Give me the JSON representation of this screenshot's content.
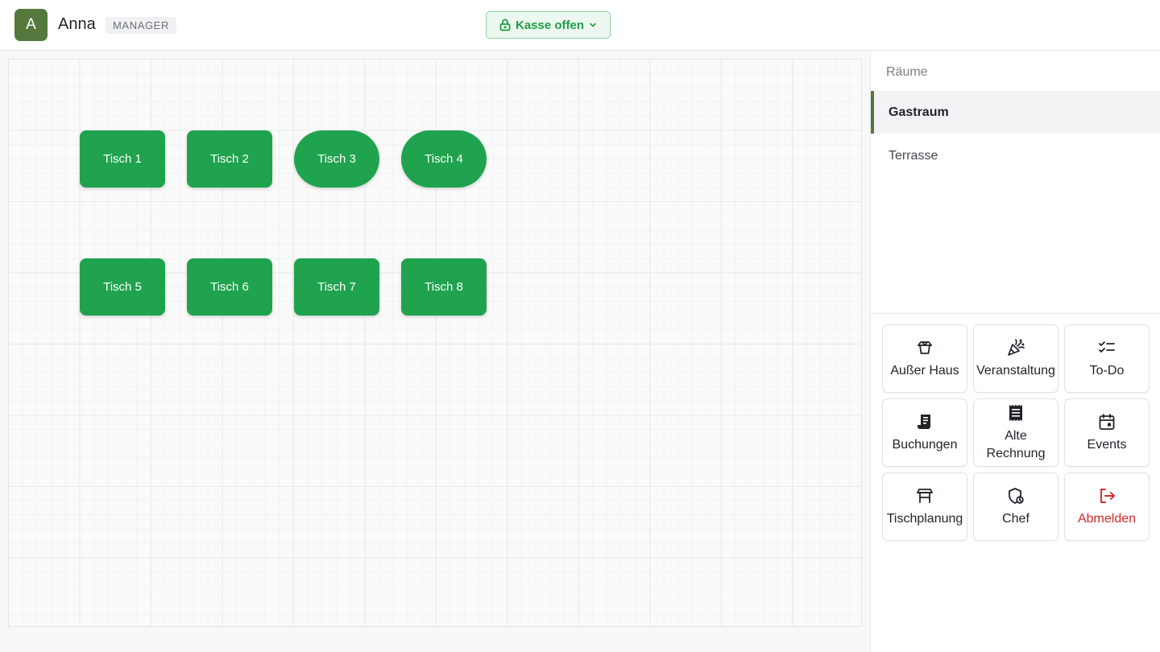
{
  "header": {
    "avatar_letter": "A",
    "user_name": "Anna",
    "role": "MANAGER",
    "kasse_label": "Kasse offen",
    "accent_green": "#1e9e48"
  },
  "floor": {
    "tables": [
      {
        "label": "Tisch 1",
        "shape": "rect"
      },
      {
        "label": "Tisch 2",
        "shape": "rect"
      },
      {
        "label": "Tisch 3",
        "shape": "round"
      },
      {
        "label": "Tisch 4",
        "shape": "round"
      },
      {
        "label": "Tisch 5",
        "shape": "rect"
      },
      {
        "label": "Tisch 6",
        "shape": "rect"
      },
      {
        "label": "Tisch 7",
        "shape": "rect"
      },
      {
        "label": "Tisch 8",
        "shape": "rect"
      }
    ],
    "table_color": "#1fa34e"
  },
  "sidebar": {
    "rooms_heading": "Räume",
    "rooms": [
      {
        "label": "Gastraum",
        "active": true
      },
      {
        "label": "Terrasse",
        "active": false
      }
    ],
    "actions": [
      {
        "label": "Außer Haus",
        "icon": "takeaway-box-icon"
      },
      {
        "label": "Veranstaltung",
        "icon": "party-popper-icon"
      },
      {
        "label": "To-Do",
        "icon": "checklist-icon"
      },
      {
        "label": "Buchungen",
        "icon": "receipt-book-icon"
      },
      {
        "label": "Alte Rechnung",
        "icon": "receipt-icon"
      },
      {
        "label": "Events",
        "icon": "calendar-icon"
      },
      {
        "label": "Tischplanung",
        "icon": "table-icon"
      },
      {
        "label": "Chef",
        "icon": "chef-shield-icon"
      },
      {
        "label": "Abmelden",
        "icon": "logout-icon",
        "danger_color": "#d12a2a"
      }
    ]
  }
}
